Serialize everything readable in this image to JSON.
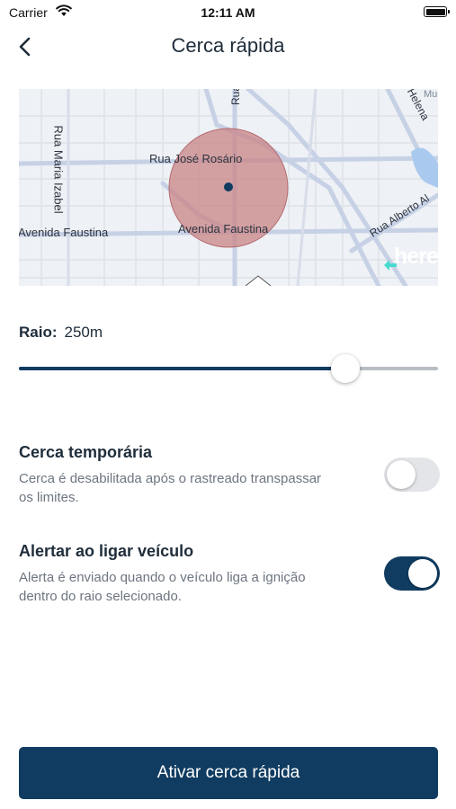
{
  "status_bar": {
    "carrier": "Carrier",
    "time": "12:11 AM"
  },
  "nav": {
    "title": "Cerca rápida",
    "back_icon": "chevron-left-icon"
  },
  "map": {
    "streets": {
      "rua_jose_rosario": "Rua José Rosário",
      "avenida_faustina_left": "Avenida Faustina",
      "avenida_faustina_right": "Avenida Faustina",
      "rua_maria_izabel": "Rua Maria Izabel",
      "rua_alberto": "Rua Alberto Al",
      "helena": "Helena",
      "rua_top": "Rua",
      "mu": "Mu"
    },
    "logo": "here",
    "geofence_color": "#c98486"
  },
  "radius": {
    "label": "Raio:",
    "value": "250m",
    "slider_fraction": 0.78
  },
  "settings": [
    {
      "title": "Cerca temporária",
      "description": "Cerca é desabilitada após o rastreado transpassar os limites.",
      "enabled": false
    },
    {
      "title": "Alertar ao ligar veículo",
      "description": "Alerta é enviado quando o veículo liga a ignição dentro do raio selecionado.",
      "enabled": true
    }
  ],
  "action": {
    "label": "Ativar cerca rápida"
  },
  "colors": {
    "primary": "#103c61",
    "toggle_off": "#e3e5e8"
  }
}
